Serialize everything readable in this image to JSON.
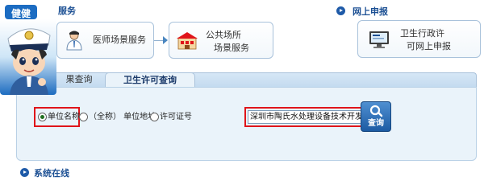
{
  "top_left": {
    "section_title": "服务"
  },
  "services": [
    {
      "label": "医师场景服务",
      "icon": "doctor-icon"
    },
    {
      "label_line1": "公共场所",
      "label_line2": "场景服务",
      "icon": "building-icon"
    }
  ],
  "online": {
    "section_title": "网上申报",
    "card_line1": "卫生行政许",
    "card_line2": "可网上申报",
    "icon": "computer-icon"
  },
  "avatar": {
    "title": "健健",
    "icon": "police-mascot-icon"
  },
  "tabs": [
    {
      "label": "果查询",
      "active": false
    },
    {
      "label": "卫生许可查询",
      "active": true
    }
  ],
  "search": {
    "radios": [
      {
        "label": "单位名称",
        "checked": true
      },
      {
        "label": "（全称） 单位地址",
        "checked": false
      },
      {
        "label": "许可证号",
        "checked": false
      }
    ],
    "input_value": "深圳市陶氏水处理设备技术开发",
    "button_label": "查询",
    "button_icon": "search-icon"
  },
  "system": {
    "section_title": "系统在线"
  },
  "colors": {
    "brand_blue": "#1b4f93",
    "highlight_red": "#e0141a",
    "panel_bg": "#eaf3fa"
  }
}
